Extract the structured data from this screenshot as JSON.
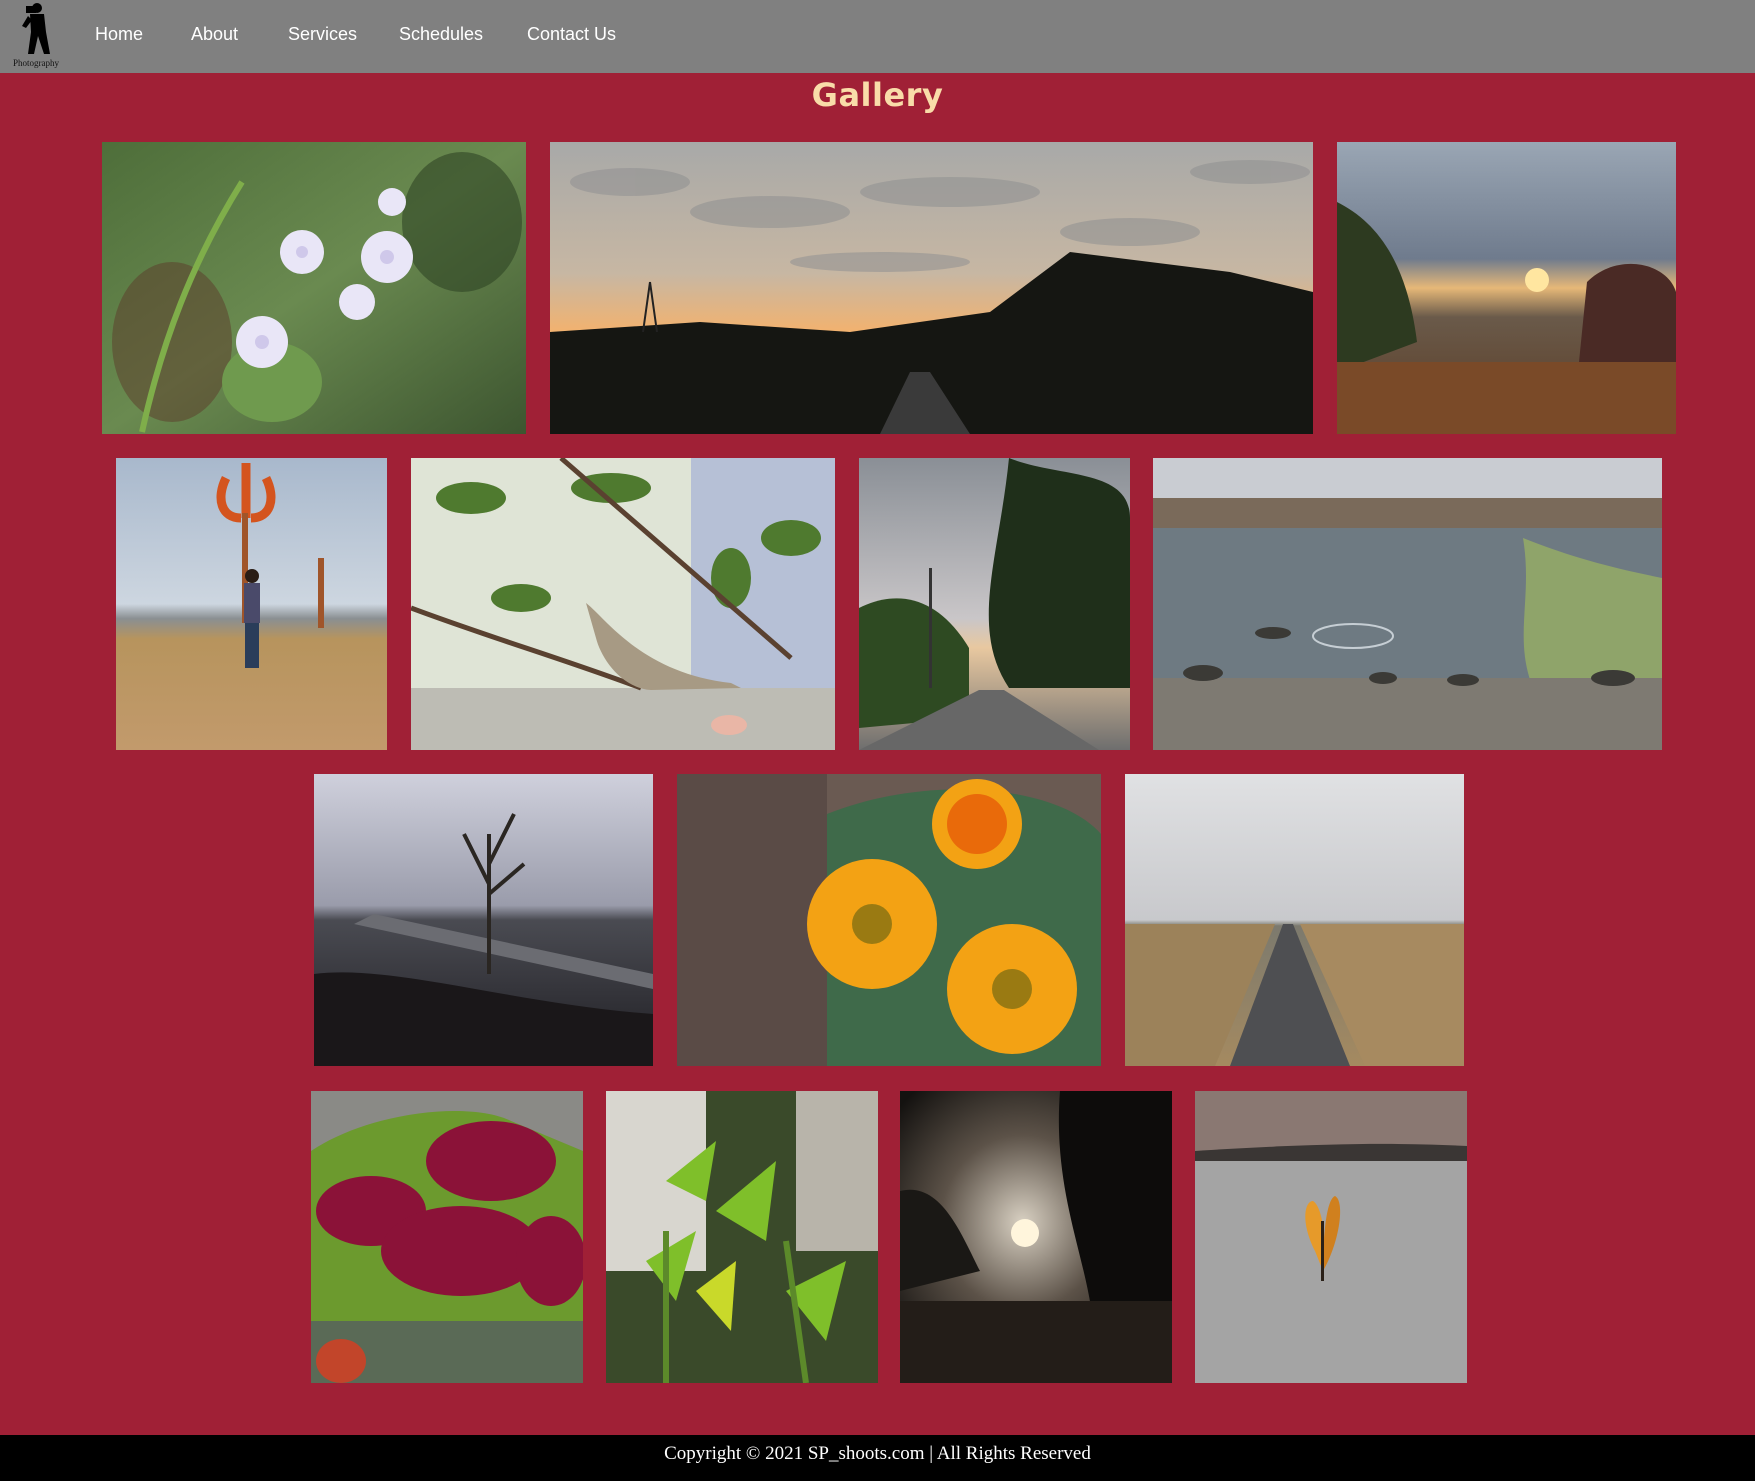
{
  "logo": {
    "icon": "photographer-silhouette-icon",
    "text": "Photography"
  },
  "nav": {
    "items": [
      "Home",
      "About",
      "Services",
      "Schedules",
      "Contact Us"
    ]
  },
  "gallery": {
    "title": "Gallery",
    "photos": [
      "white-flowers-photo",
      "sunset-road-panorama-photo",
      "sunrise-field-photo",
      "trident-hill-photo",
      "lizard-branch-photo",
      "tree-lined-road-photo",
      "lake-rocks-photo",
      "bare-tree-highway-photo",
      "orange-marigolds-photo",
      "empty-road-photo",
      "coleus-leaves-photo",
      "papaya-plant-photo",
      "dusk-sun-trees-photo",
      "butterfly-photo"
    ]
  },
  "footer": {
    "text": "Copyright © 2021 SP_shoots.com | All Rights Reserved"
  }
}
